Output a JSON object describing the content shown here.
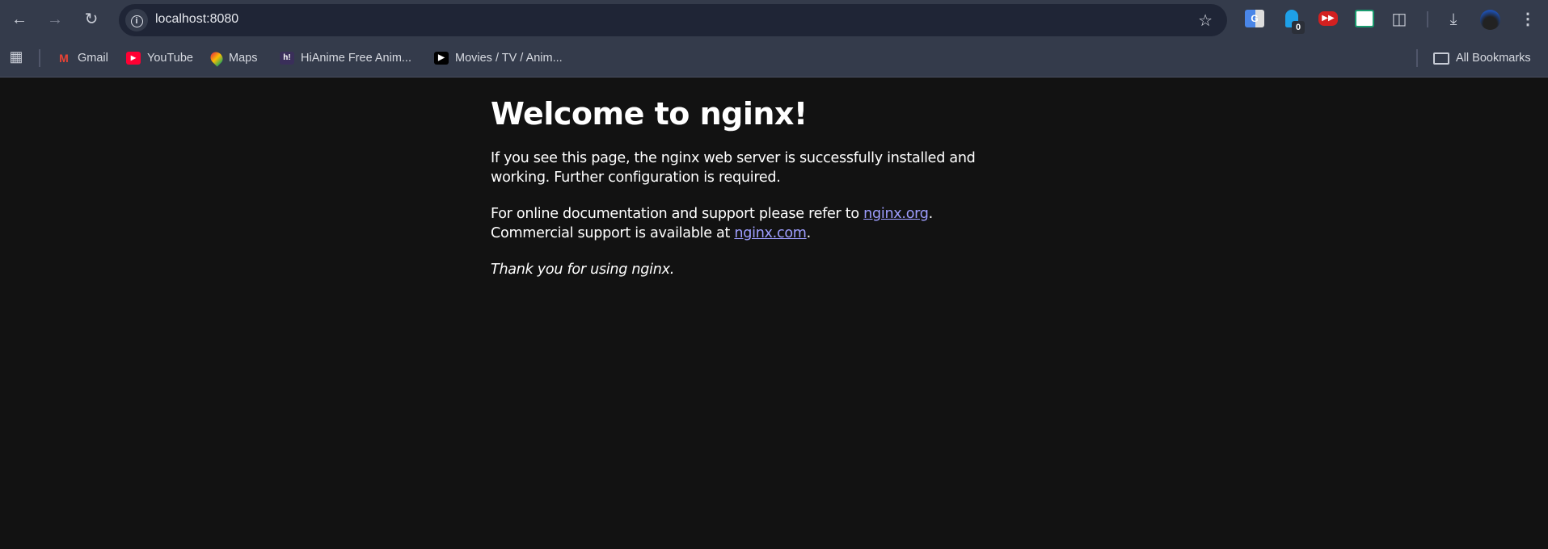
{
  "browser": {
    "url": "localhost:8080",
    "icons": {
      "back": "arrow-left",
      "forward": "arrow-right",
      "reload": "reload",
      "info": "info",
      "star": "star",
      "downloads": "download",
      "menu": "kebab"
    },
    "extension_badge": "0",
    "bookmarks": [
      {
        "label": "Gmail",
        "icon": "gmail"
      },
      {
        "label": "YouTube",
        "icon": "youtube"
      },
      {
        "label": "Maps",
        "icon": "maps"
      },
      {
        "label": "HiAnime Free Anim...",
        "icon": "hianime"
      },
      {
        "label": "Movies / TV / Anim...",
        "icon": "play"
      }
    ],
    "all_bookmarks": "All Bookmarks"
  },
  "page": {
    "title": "Welcome to nginx!",
    "p1": "If you see this page, the nginx web server is successfully installed and working. Further configuration is required.",
    "p2_pre": "For online documentation and support please refer to ",
    "link1": "nginx.org",
    "p2_mid": ".",
    "p2_line2": "Commercial support is available at ",
    "link2": "nginx.com",
    "p2_end": ".",
    "thanks": "Thank you for using nginx.",
    "link_color": "#9e9eff"
  }
}
